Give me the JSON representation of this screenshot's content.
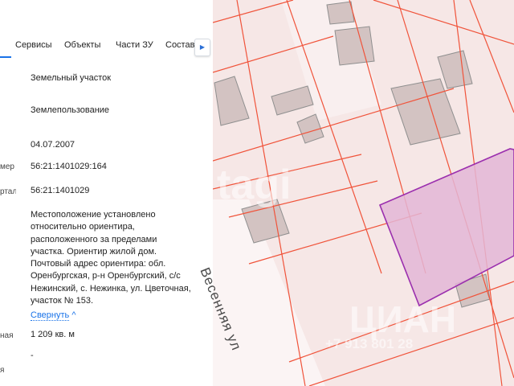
{
  "tabs": [
    "Сервисы",
    "Объекты",
    "Части ЗУ",
    "Состав"
  ],
  "tab_more_icon": "chevron-right-icon",
  "rows": [
    {
      "label": "",
      "value": "Земельный участок"
    },
    {
      "label": "",
      "value": "Землепользование"
    },
    {
      "label": "",
      "value": "04.07.2007"
    },
    {
      "label": "мер",
      "value": "56:21:1401029:164"
    },
    {
      "label": "ртал",
      "value": "56:21:1401029"
    }
  ],
  "address_lines": [
    "Местоположение установлено",
    "относительно ориентира,",
    "расположенного за пределами",
    "участка. Ориентир жилой дом.",
    "Почтовый адрес ориентира: обл.",
    "Оренбургская, р-н Оренбургский, с/с",
    "Нежинский, с. Нежинка, ул. Цветочная,",
    "участок № 153."
  ],
  "collapse_link": {
    "label": "Свернуть",
    "arrow": "^"
  },
  "area_row": {
    "label": "ная",
    "value": "1 209 кв. м"
  },
  "empty_row": {
    "label": "",
    "value": "-"
  },
  "last_row": {
    "label": "я"
  },
  "map": {
    "street_name": "Весенняя ул",
    "watermark_left": "tagi",
    "watermark_brand": "ЦИАН",
    "watermark_phone": "+7 913 801 28"
  },
  "colors": {
    "accent": "#1a73e8",
    "parcel_line": "#f0533a",
    "selected_parcel_fill": "#e3b6d6",
    "selected_parcel_stroke": "#9b2fae"
  }
}
